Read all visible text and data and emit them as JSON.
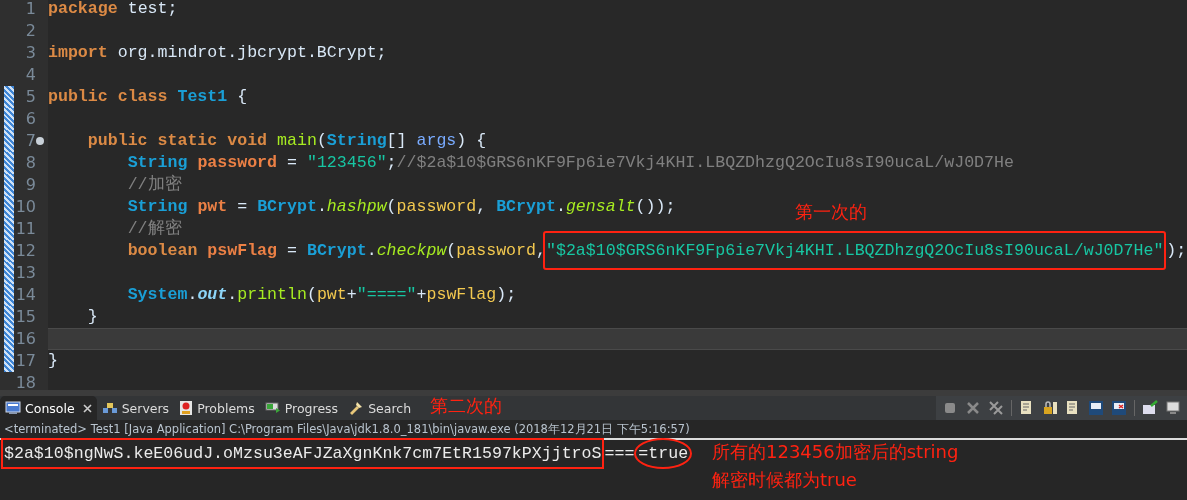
{
  "editor": {
    "lines": [
      {
        "number": "1",
        "changed": false,
        "fold": false,
        "tokens": [
          {
            "text": "package",
            "kind": "keyword"
          },
          {
            "text": " test;",
            "kind": "plain"
          }
        ]
      },
      {
        "number": "2",
        "changed": false,
        "fold": false
      },
      {
        "number": "3",
        "changed": false,
        "fold": false,
        "tokens": [
          {
            "text": "import",
            "kind": "keyword"
          },
          {
            "text": " org.mindrot.jbcrypt.BCrypt;",
            "kind": "plain"
          }
        ]
      },
      {
        "number": "4",
        "changed": false,
        "fold": false
      },
      {
        "number": "5",
        "changed": true,
        "fold": false,
        "tokens": [
          {
            "text": "public class ",
            "kind": "keyword"
          },
          {
            "text": "Test1",
            "kind": "class"
          },
          {
            "text": " {",
            "kind": "plain"
          }
        ],
        "children": [
          {
            "number": "6",
            "changed": true,
            "fold": false
          },
          {
            "number": "7",
            "changed": true,
            "fold": true,
            "tokens": [
              {
                "text": "public static void ",
                "kind": "keyword"
              },
              {
                "text": "main",
                "kind": "method"
              },
              {
                "text": "(",
                "kind": "plain"
              },
              {
                "text": "String",
                "kind": "class"
              },
              {
                "text": "[] ",
                "kind": "plain"
              },
              {
                "text": "args",
                "kind": "param"
              },
              {
                "text": ") {",
                "kind": "plain"
              }
            ],
            "children": [
              {
                "number": "8",
                "changed": true,
                "fold": false,
                "tokens": [
                  {
                    "text": "String ",
                    "kind": "class"
                  },
                  {
                    "text": "password",
                    "kind": "declaration"
                  },
                  {
                    "text": " = ",
                    "kind": "plain"
                  },
                  {
                    "text": "\"123456\"",
                    "kind": "string"
                  },
                  {
                    "text": ";",
                    "kind": "plain"
                  },
                  {
                    "text": "//$2a$10$GRS6nKF9Fp6ie7Vkj4KHI.LBQZDhzgQ2OcIu8sI90ucaL/wJ0D7He",
                    "kind": "comment"
                  }
                ]
              },
              {
                "number": "9",
                "changed": true,
                "fold": false,
                "tokens": [
                  {
                    "text": "//加密",
                    "kind": "comment"
                  }
                ]
              },
              {
                "number": "10",
                "changed": true,
                "fold": false,
                "tokens": [
                  {
                    "text": "String ",
                    "kind": "class"
                  },
                  {
                    "text": "pwt",
                    "kind": "declaration"
                  },
                  {
                    "text": " = ",
                    "kind": "plain"
                  },
                  {
                    "text": "BCrypt",
                    "kind": "class"
                  },
                  {
                    "text": ".",
                    "kind": "plain"
                  },
                  {
                    "text": "hashpw",
                    "kind": "static-method"
                  },
                  {
                    "text": "(",
                    "kind": "plain"
                  },
                  {
                    "text": "password",
                    "kind": "variable"
                  },
                  {
                    "text": ", ",
                    "kind": "plain"
                  },
                  {
                    "text": "BCrypt",
                    "kind": "class"
                  },
                  {
                    "text": ".",
                    "kind": "plain"
                  },
                  {
                    "text": "gensalt",
                    "kind": "static-method"
                  },
                  {
                    "text": "());",
                    "kind": "plain"
                  }
                ]
              },
              {
                "number": "11",
                "changed": true,
                "fold": false,
                "tokens": [
                  {
                    "text": "//解密",
                    "kind": "comment"
                  }
                ]
              },
              {
                "number": "12",
                "changed": true,
                "fold": false,
                "tokens": [
                  {
                    "text": "boolean ",
                    "kind": "keyword"
                  },
                  {
                    "text": "pswFlag",
                    "kind": "declaration"
                  },
                  {
                    "text": " = ",
                    "kind": "plain"
                  },
                  {
                    "text": "BCrypt",
                    "kind": "class"
                  },
                  {
                    "text": ".",
                    "kind": "plain"
                  },
                  {
                    "text": "checkpw",
                    "kind": "static-method"
                  },
                  {
                    "text": "(",
                    "kind": "plain"
                  },
                  {
                    "text": "password",
                    "kind": "variable"
                  },
                  {
                    "text": ",",
                    "kind": "plain"
                  },
                  {
                    "text": "\"$2a$10$GRS6nKF9Fp6ie7Vkj4KHI.LBQZDhzgQ2OcIu8sI90ucaL/wJ0D7He\"",
                    "kind": "string",
                    "boxed": true
                  },
                  {
                    "text": ");",
                    "kind": "plain"
                  }
                ]
              },
              {
                "number": "13",
                "changed": true,
                "fold": false
              },
              {
                "number": "14",
                "changed": true,
                "fold": false,
                "tokens": [
                  {
                    "text": "System",
                    "kind": "class"
                  },
                  {
                    "text": ".",
                    "kind": "plain"
                  },
                  {
                    "text": "out",
                    "kind": "static-field"
                  },
                  {
                    "text": ".",
                    "kind": "plain"
                  },
                  {
                    "text": "println",
                    "kind": "method"
                  },
                  {
                    "text": "(",
                    "kind": "plain"
                  },
                  {
                    "text": "pwt",
                    "kind": "variable"
                  },
                  {
                    "text": "+",
                    "kind": "plain"
                  },
                  {
                    "text": "\"====\"",
                    "kind": "string"
                  },
                  {
                    "text": "+",
                    "kind": "plain"
                  },
                  {
                    "text": "pswFlag",
                    "kind": "variable"
                  },
                  {
                    "text": ");",
                    "kind": "plain"
                  }
                ]
              }
            ]
          },
          {
            "number": "15",
            "changed": true,
            "fold": false,
            "tokens": [
              {
                "text": "}",
                "kind": "plain"
              }
            ]
          },
          {
            "number": "16",
            "changed": true,
            "current": true,
            "fold": false
          }
        ]
      },
      {
        "number": "17",
        "changed": true,
        "fold": false,
        "tokens": [
          {
            "text": "}",
            "kind": "plain"
          }
        ]
      },
      {
        "number": "18",
        "changed": false,
        "fold": false
      }
    ]
  },
  "panel": {
    "tabs": [
      {
        "label": "Console",
        "selected": true,
        "closable": true
      },
      {
        "label": "Servers",
        "selected": false,
        "closable": false
      },
      {
        "label": "Problems",
        "selected": false,
        "closable": false
      },
      {
        "label": "Progress",
        "selected": false,
        "closable": false
      },
      {
        "label": "Search",
        "selected": false,
        "closable": false
      }
    ],
    "status": "<terminated> Test1 [Java Application] C:\\Program Files\\Java\\jdk1.8.0_181\\bin\\javaw.exe (2018年12月21日 下午5:16:57)",
    "output": [
      {
        "text": "$2a$10$ngNwS.keE06udJ.oMzsu3eAFJZaXgnKnk7cm7EtR1597kPXjjtroS",
        "boxed": true,
        "circled": false
      },
      {
        "text": "===",
        "boxed": false,
        "circled": false
      },
      {
        "text": "=true",
        "boxed": false,
        "circled": true
      }
    ]
  },
  "annotations": [
    {
      "text": "第一次的"
    },
    {
      "text": "第二次的"
    },
    {
      "text": "所有的123456加密后的string"
    },
    {
      "text": "解密时候都为true"
    }
  ]
}
